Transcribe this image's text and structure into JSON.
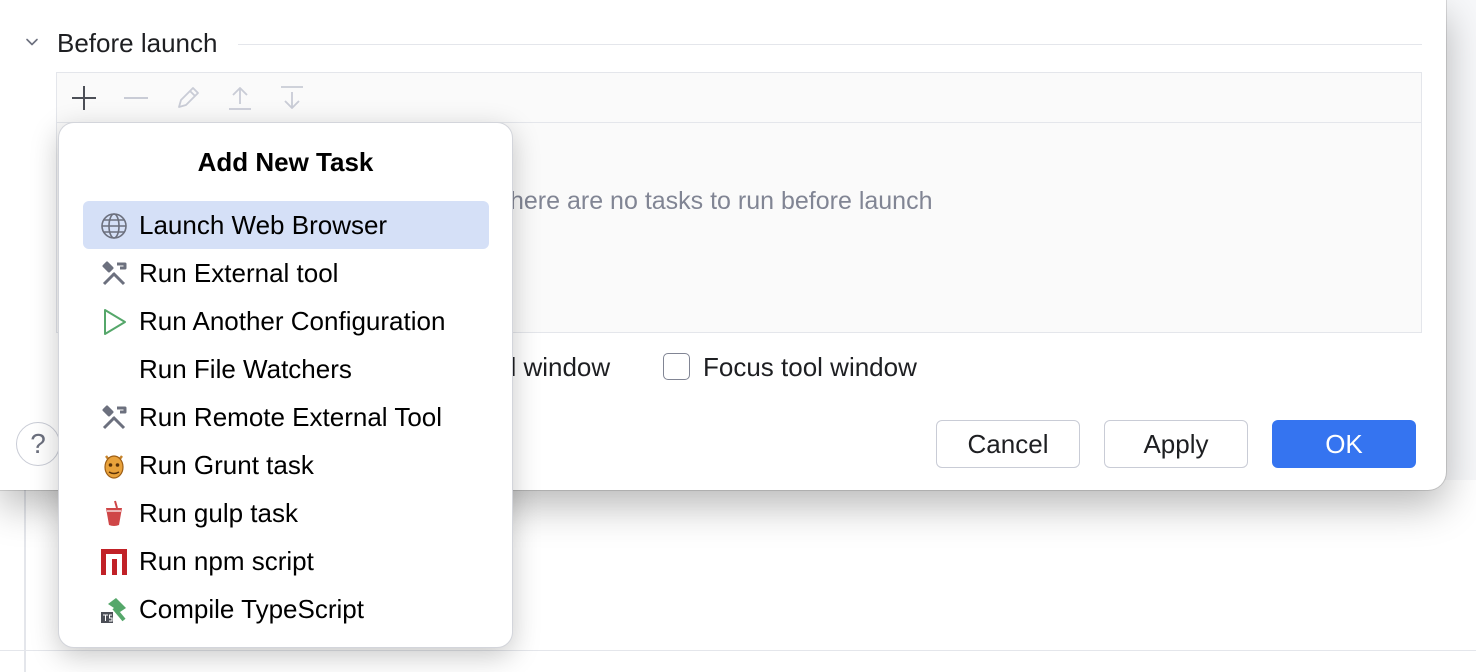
{
  "section": {
    "title": "Before launch"
  },
  "tasks": {
    "empty_text": "here are no tasks to run before launch"
  },
  "options": {
    "partial_label": "ol window",
    "focus_label": "Focus tool window",
    "focus_checked": false
  },
  "buttons": {
    "cancel": "Cancel",
    "apply": "Apply",
    "ok": "OK",
    "help": "?"
  },
  "popup": {
    "title": "Add New Task",
    "items": [
      {
        "label": "Launch Web Browser",
        "icon": "globe-icon",
        "selected": true
      },
      {
        "label": "Run External tool",
        "icon": "tools-icon"
      },
      {
        "label": "Run Another Configuration",
        "icon": "run-icon"
      },
      {
        "label": "Run File Watchers",
        "icon": "none"
      },
      {
        "label": "Run Remote External Tool",
        "icon": "tools-icon"
      },
      {
        "label": "Run Grunt task",
        "icon": "grunt-icon"
      },
      {
        "label": "Run gulp task",
        "icon": "gulp-icon"
      },
      {
        "label": "Run npm script",
        "icon": "npm-icon"
      },
      {
        "label": "Compile TypeScript",
        "icon": "typescript-compile-icon"
      }
    ]
  },
  "colors": {
    "accent": "#3574f0",
    "selection": "#d5e0f7",
    "muted_text": "#818594"
  }
}
